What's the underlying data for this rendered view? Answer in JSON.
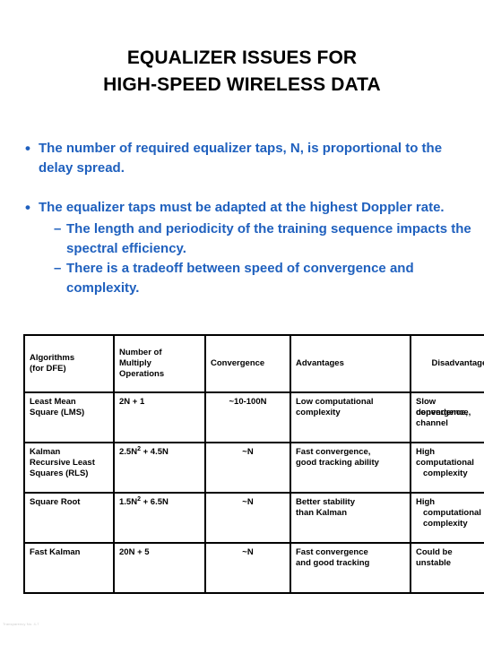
{
  "slide": {
    "title_lines": [
      "EQUALIZER ISSUES FOR",
      "HIGH-SPEED WIRELESS DATA"
    ],
    "accent_color": "#1F60BE",
    "text_color": "#000000",
    "background_color": "#FFFFFF"
  },
  "bullets": [
    {
      "marker": "•",
      "text": "The number of required equalizer taps, N, is proportional to the delay spread."
    },
    {
      "marker": "•",
      "text": "The equalizer taps must be adapted at the highest Doppler rate.",
      "sub_bullets": [
        {
          "marker": "–",
          "text": "The length and periodicity of the training sequence impacts the spectral efficiency."
        },
        {
          "marker": "–",
          "text": "There is a tradeoff between speed of convergence and complexity."
        }
      ]
    }
  ],
  "table": {
    "headers": [
      "Algorithms (for DFE)",
      "Number of Multiply Operations",
      "Convergence",
      "Advantages",
      "Disadvantages"
    ],
    "header_lines": {
      "algorithms": [
        "Algorithms",
        "(for DFE)"
      ],
      "operations": [
        "Number of",
        "Multiply",
        "Operations"
      ],
      "convergence": "Convergence",
      "advantages": "Advantages",
      "disadvantages": "Disadvantages"
    },
    "rows": [
      {
        "algorithm_lines": [
          "Least Mean",
          "Square (LMS)"
        ],
        "operations_prefix": "2N + 1",
        "operations_exponent": "",
        "operations_suffix": "",
        "convergence": "~10-100N",
        "advantages_lines": [
          "Low computational",
          "complexity"
        ],
        "disadvantages_lines": [
          "Slow",
          "channel"
        ],
        "disadvantages_overlap": [
          "convergence,",
          "dependence,"
        ]
      },
      {
        "algorithm_lines": [
          "Kalman",
          "Recursive Least",
          "Squares (RLS)"
        ],
        "operations_prefix": "2.5N",
        "operations_exponent": "2",
        "operations_suffix": " + 4.5N",
        "convergence": "~N",
        "advantages_lines": [
          "Fast convergence,",
          "good tracking ability"
        ],
        "disadvantages_lines": [
          "High",
          "computational",
          "complexity"
        ]
      },
      {
        "algorithm_lines": [
          "Square Root"
        ],
        "operations_prefix": "1.5N",
        "operations_exponent": "2",
        "operations_suffix": " + 6.5N",
        "convergence": "~N",
        "advantages_lines": [
          "Better stability",
          "than Kalman"
        ],
        "disadvantages_lines": [
          "High",
          "computational",
          "complexity"
        ]
      },
      {
        "algorithm_lines": [
          "Fast Kalman"
        ],
        "operations_prefix": "20N + 5",
        "operations_exponent": "",
        "operations_suffix": "",
        "convergence": "~N",
        "advantages_lines": [
          "Fast convergence",
          "and good tracking"
        ],
        "disadvantages_lines": [
          "Could be",
          "unstable"
        ]
      }
    ]
  },
  "footer": {
    "note": "Transparency No. 4-7"
  }
}
